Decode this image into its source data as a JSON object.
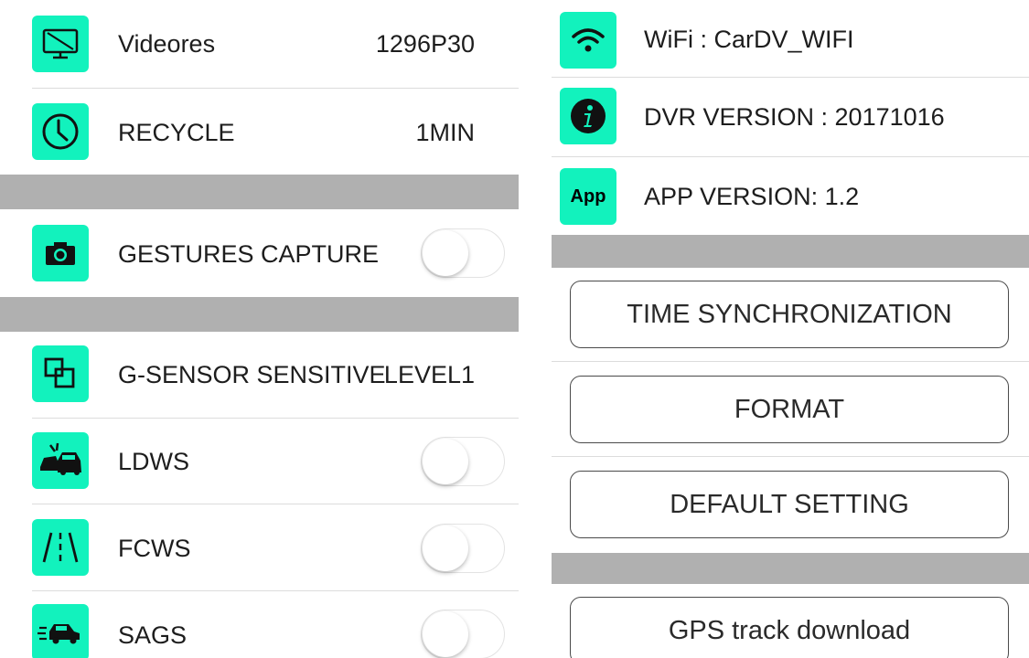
{
  "left": {
    "videores": {
      "label": "Videores",
      "value": "1296P30",
      "icon": "monitor-icon"
    },
    "recycle": {
      "label": "RECYCLE",
      "value": "1MIN",
      "icon": "clock-icon"
    },
    "gestures": {
      "label": "GESTURES CAPTURE",
      "icon": "camera-icon",
      "toggle_on": false
    },
    "gsensor": {
      "label": "G-SENSOR SENSITIVE",
      "value": "LEVEL1",
      "icon": "overlap-squares-icon"
    },
    "ldws": {
      "label": "LDWS",
      "icon": "car-crash-icon",
      "toggle_on": false
    },
    "fcws": {
      "label": "FCWS",
      "icon": "road-lanes-icon",
      "toggle_on": false
    },
    "sags": {
      "label": "SAGS",
      "icon": "moving-car-icon",
      "toggle_on": false
    }
  },
  "right": {
    "wifi": {
      "label": "WiFi : CarDV_WIFI",
      "icon": "wifi-icon"
    },
    "dvr_version": {
      "label": "DVR VERSION : 20171016",
      "icon": "info-icon"
    },
    "app_version": {
      "label": "APP VERSION: 1.2",
      "icon_text": "App"
    },
    "buttons": {
      "time_sync": "TIME SYNCHRONIZATION",
      "format": "FORMAT",
      "default_setting": "DEFAULT SETTING",
      "gps_download": "GPS track download"
    }
  },
  "colors": {
    "accent": "#12f2bd",
    "section_band": "#b0b0b0",
    "divider": "#dcdcdc"
  }
}
